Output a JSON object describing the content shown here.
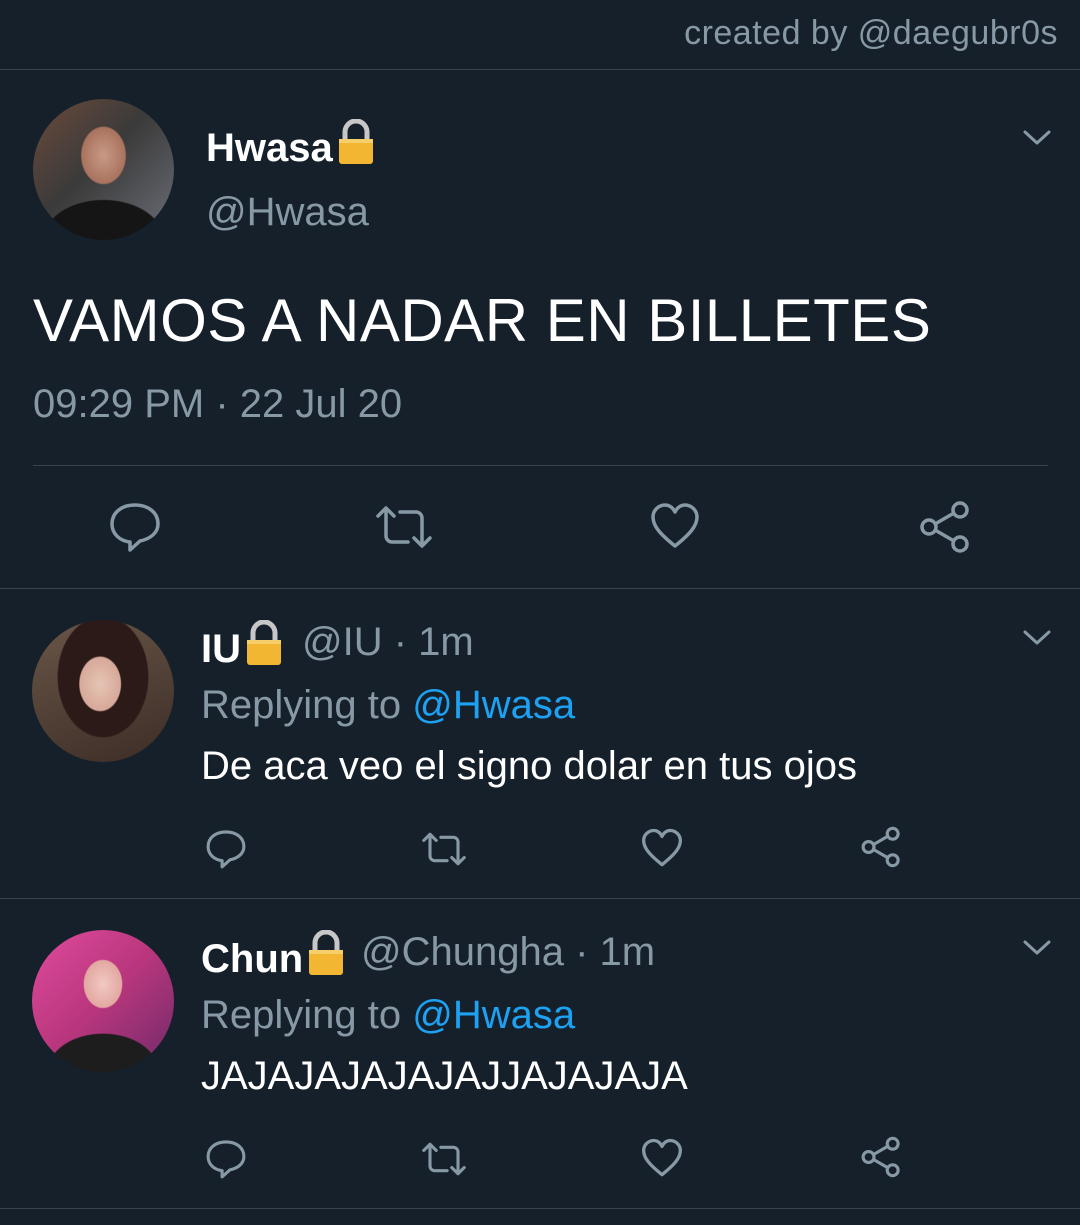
{
  "credit": "created by @daegubr0s",
  "main_tweet": {
    "name": "Hwasa",
    "handle": "@Hwasa",
    "text": "VAMOS A NADAR EN BILLETES",
    "timestamp": "09:29 PM · 22 Jul 20",
    "avatar_icon": "hwasa-avatar",
    "lock_icon": "lock-icon"
  },
  "replies": [
    {
      "name": "IU",
      "handle_time": "@IU · 1m",
      "replying_prefix": "Replying to",
      "replying_to": "@Hwasa",
      "text": "De aca veo el signo dolar en tus ojos",
      "avatar_icon": "iu-avatar"
    },
    {
      "name": "Chun",
      "handle_time": "@Chungha · 1m",
      "replying_prefix": "Replying to",
      "replying_to": "@Hwasa",
      "text": "JAJAJAJAJAJAJJAJAJAJA",
      "avatar_icon": "chungha-avatar"
    }
  ],
  "colors": {
    "background": "#15202b",
    "divider": "#38444d",
    "secondary_text": "#8899a6",
    "link": "#1da1f2",
    "lock": "#f2b632"
  }
}
